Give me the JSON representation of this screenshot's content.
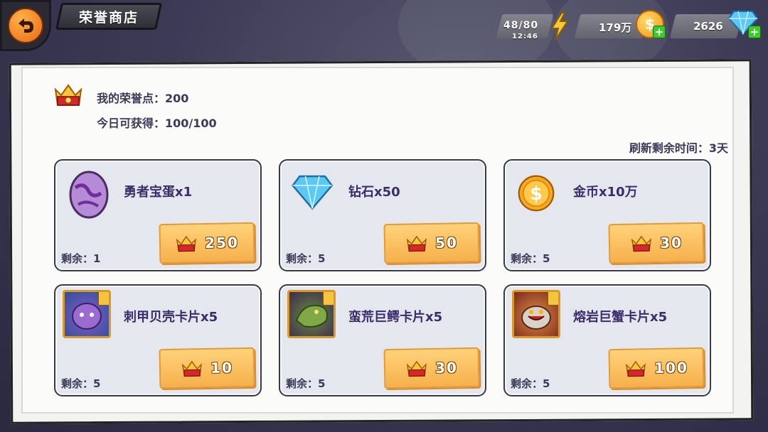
{
  "header": {
    "title": "荣誉商店",
    "energy": "48/80",
    "energy_timer": "12:46",
    "gold": "179万",
    "gems": "2626"
  },
  "honor": {
    "points_label": "我的荣誉点：200",
    "daily_label": "今日可获得：100/100",
    "refresh_label": "刷新剩余时间：3天"
  },
  "items": [
    {
      "name": "勇者宝蛋x1",
      "price": "250",
      "remain": "剩余：1",
      "icon": "egg-icon"
    },
    {
      "name": "钻石x50",
      "price": "50",
      "remain": "剩余：5",
      "icon": "diamond-icon"
    },
    {
      "name": "金币x10万",
      "price": "30",
      "remain": "剩余：5",
      "icon": "gold-coin-icon"
    },
    {
      "name": "刺甲贝壳卡片x5",
      "price": "10",
      "remain": "剩余：5",
      "icon": "shell-monster-portrait"
    },
    {
      "name": "蛮荒巨鳄卡片x5",
      "price": "30",
      "remain": "剩余：5",
      "icon": "crocodile-portrait"
    },
    {
      "name": "熔岩巨蟹卡片x5",
      "price": "100",
      "remain": "剩余：5",
      "icon": "lava-crab-portrait"
    }
  ],
  "colors": {
    "accent_orange": "#f6b04c",
    "text_purple": "#3b2d6b",
    "card_bg": "#e4e7ee"
  }
}
